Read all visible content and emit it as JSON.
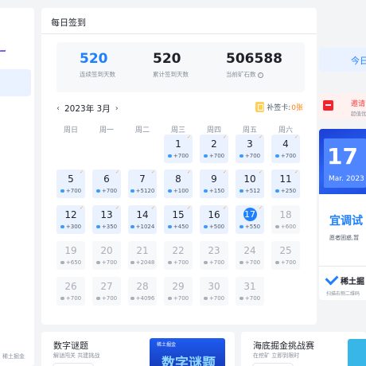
{
  "sidebar": {
    "footer_text": "稀土掘金"
  },
  "main": {
    "title": "每日签到",
    "stats": [
      {
        "value": "520",
        "label": "连续签到天数"
      },
      {
        "value": "520",
        "label": "累计签到天数"
      },
      {
        "value": "506588",
        "label": "当前矿石数"
      }
    ],
    "info_icon_glyph": "i",
    "month_label": "2023年 3月",
    "prev_arrow": "‹",
    "next_arrow": "›",
    "makeup_label": "补签卡:",
    "makeup_count": "0张",
    "weekdays": [
      "周日",
      "周一",
      "周二",
      "周三",
      "周四",
      "周五",
      "周六"
    ],
    "days": [
      {
        "day": "1",
        "points": "+700",
        "state": "signed"
      },
      {
        "day": "2",
        "points": "+700",
        "state": "signed"
      },
      {
        "day": "3",
        "points": "+700",
        "state": "signed"
      },
      {
        "day": "4",
        "points": "+700",
        "state": "signed"
      },
      {
        "day": "5",
        "points": "+700",
        "state": "signed"
      },
      {
        "day": "6",
        "points": "+700",
        "state": "signed"
      },
      {
        "day": "7",
        "points": "+5120",
        "state": "signed"
      },
      {
        "day": "8",
        "points": "+100",
        "state": "signed"
      },
      {
        "day": "9",
        "points": "+150",
        "state": "signed"
      },
      {
        "day": "10",
        "points": "+512",
        "state": "signed"
      },
      {
        "day": "11",
        "points": "+250",
        "state": "signed"
      },
      {
        "day": "12",
        "points": "+300",
        "state": "signed"
      },
      {
        "day": "13",
        "points": "+350",
        "state": "signed"
      },
      {
        "day": "14",
        "points": "+1024",
        "state": "signed"
      },
      {
        "day": "15",
        "points": "+450",
        "state": "signed"
      },
      {
        "day": "16",
        "points": "+500",
        "state": "signed"
      },
      {
        "day": "17",
        "points": "+550",
        "state": "today"
      },
      {
        "day": "18",
        "points": "+600",
        "state": "future"
      },
      {
        "day": "19",
        "points": "+650",
        "state": "future"
      },
      {
        "day": "20",
        "points": "+700",
        "state": "future"
      },
      {
        "day": "21",
        "points": "+2048",
        "state": "future"
      },
      {
        "day": "22",
        "points": "+700",
        "state": "future"
      },
      {
        "day": "23",
        "points": "+700",
        "state": "future"
      },
      {
        "day": "24",
        "points": "+700",
        "state": "future"
      },
      {
        "day": "25",
        "points": "+700",
        "state": "future"
      },
      {
        "day": "26",
        "points": "+700",
        "state": "future"
      },
      {
        "day": "27",
        "points": "+700",
        "state": "future"
      },
      {
        "day": "28",
        "points": "+4096",
        "state": "future"
      },
      {
        "day": "29",
        "points": "+700",
        "state": "future"
      },
      {
        "day": "30",
        "points": "+700",
        "state": "future"
      },
      {
        "day": "31",
        "points": "+700",
        "state": "future"
      }
    ],
    "first_weekday_index": 3,
    "check_glyph": "✓"
  },
  "right": {
    "checkin_label": "今日",
    "invite_title": "邀请",
    "invite_sub": "超值优",
    "promo_day": "17",
    "promo_month": "Mar. 2023",
    "promo_headline": "宜调试",
    "promo_desc": "愿者困惑,暂",
    "promo_logo": "稀土掘",
    "promo_logo_sub": "扫描右侧二维码"
  },
  "cards": [
    {
      "title": "数字谜题",
      "subtitle": "解谜闯关 共建挑战",
      "thumb_tag": "稀土掘金",
      "thumb_text": "数字谜题"
    },
    {
      "title": "海底掘金挑战赛",
      "subtitle": "在挖矿 立即到限时"
    }
  ],
  "colors": {
    "accent": "#1e80ff",
    "makeup": "#ff7d00",
    "check": "#ff9f2e",
    "invite": "#f53f3f"
  }
}
